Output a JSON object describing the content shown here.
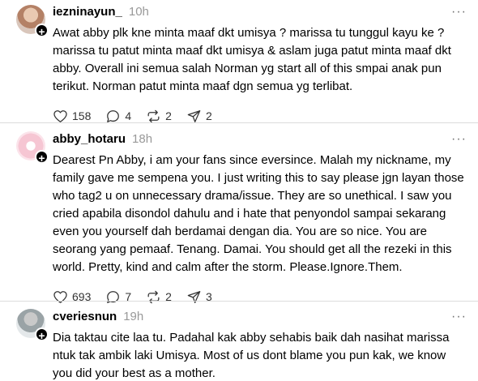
{
  "posts": [
    {
      "username": "iezninayun_",
      "time": "10h",
      "text": "Awat abby plk kne minta maaf dkt umisya ? marissa tu tunggul kayu ke ? marissa tu patut minta maaf dkt umisya & aslam juga patut minta maaf dkt abby. Overall ini semua salah Norman yg start all of this smpai anak pun terikut. Norman patut minta maaf dgn semua yg terlibat.",
      "likes": "158",
      "replies": "4",
      "reposts": "2",
      "shares": "2"
    },
    {
      "username": "abby_hotaru",
      "time": "18h",
      "text": "Dearest Pn Abby, i am your fans since eversince. Malah my nickname, my family gave me sempena you. I just writing this to say please jgn layan those who tag2 u on unnecessary drama/issue. They are so unethical. I saw you cried apabila disondol dahulu and i hate that penyondol sampai sekarang even you yourself dah berdamai dengan dia. You are so nice. You are seorang yang pemaaf. Tenang. Damai. You should get all the rezeki in this world. Pretty, kind and calm after the storm. Please.Ignore.Them.",
      "likes": "693",
      "replies": "7",
      "reposts": "2",
      "shares": "3"
    },
    {
      "username": "cveriesnun",
      "time": "19h",
      "text": "Dia taktau cite laa tu. Padahal kak abby sehabis baik dah nasihat marissa ntuk tak ambik laki Umisya. Most of us dont blame you pun kak, we know you did your best as a mother."
    }
  ],
  "icons": {
    "follow": "+",
    "more": "···"
  }
}
